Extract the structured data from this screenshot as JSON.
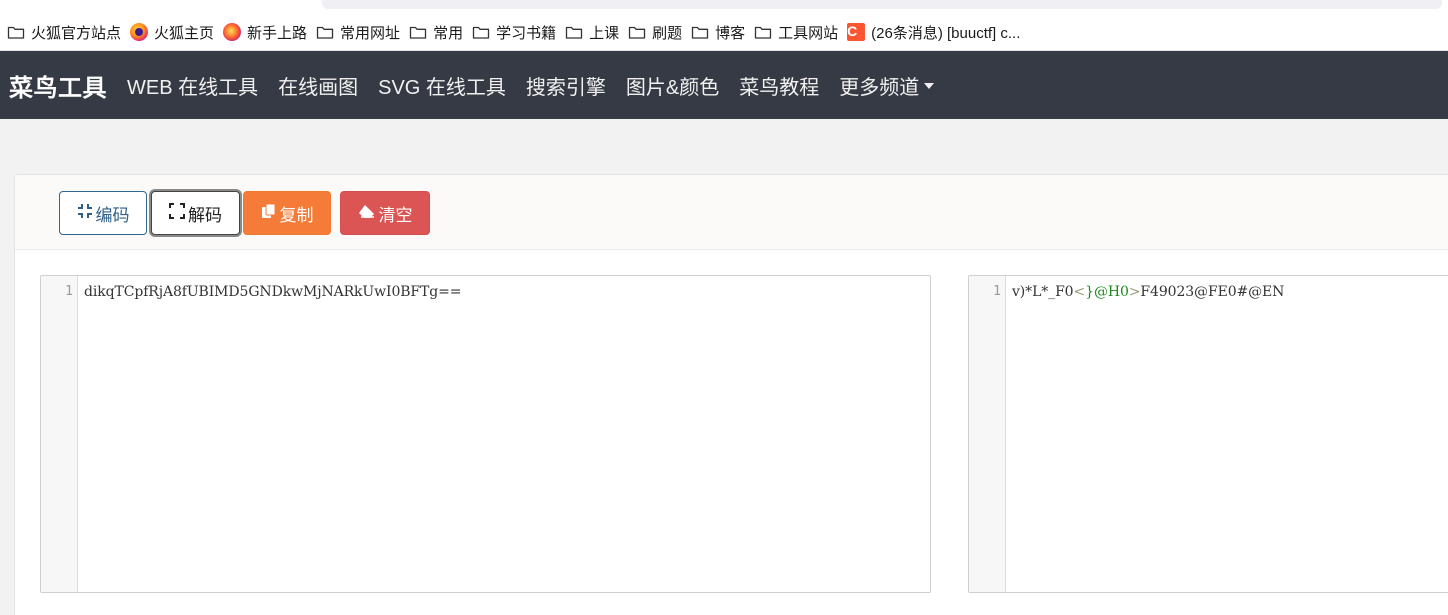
{
  "bookmarks": [
    {
      "label": "火狐官方站点",
      "icon": "folder-icon"
    },
    {
      "label": "火狐主页",
      "icon": "firefox-icon"
    },
    {
      "label": "新手上路",
      "icon": "firefox-nightly-icon"
    },
    {
      "label": "常用网址",
      "icon": "folder-icon"
    },
    {
      "label": "常用",
      "icon": "folder-icon"
    },
    {
      "label": "学习书籍",
      "icon": "folder-icon"
    },
    {
      "label": "上课",
      "icon": "folder-icon"
    },
    {
      "label": "刷题",
      "icon": "folder-icon"
    },
    {
      "label": "博客",
      "icon": "folder-icon"
    },
    {
      "label": "工具网站",
      "icon": "folder-icon"
    },
    {
      "label": "(26条消息) [buuctf] c...",
      "icon": "csdn-icon"
    }
  ],
  "navbar": {
    "brand": "菜鸟工具",
    "items": [
      "WEB 在线工具",
      "在线画图",
      "SVG 在线工具",
      "搜索引擎",
      "图片&颜色",
      "菜鸟教程",
      "更多频道"
    ]
  },
  "toolbar": {
    "encode_label": "编码",
    "decode_label": "解码",
    "copy_label": "复制",
    "clear_label": "清空"
  },
  "editor_left": {
    "line_number": "1",
    "content": "dikqTCpfRjA8fUBIMD5GNDkwMjNARkUwI0BFTg=="
  },
  "editor_right": {
    "line_number": "1",
    "content_parts": [
      "v)*L*_F0",
      "<",
      "}@H0",
      ">",
      "F49023@FE0#@EN"
    ]
  },
  "colors": {
    "navbar_bg": "#363a44",
    "encode_border": "#33668f",
    "copy_bg": "#f57c38",
    "clear_bg": "#da5553"
  }
}
